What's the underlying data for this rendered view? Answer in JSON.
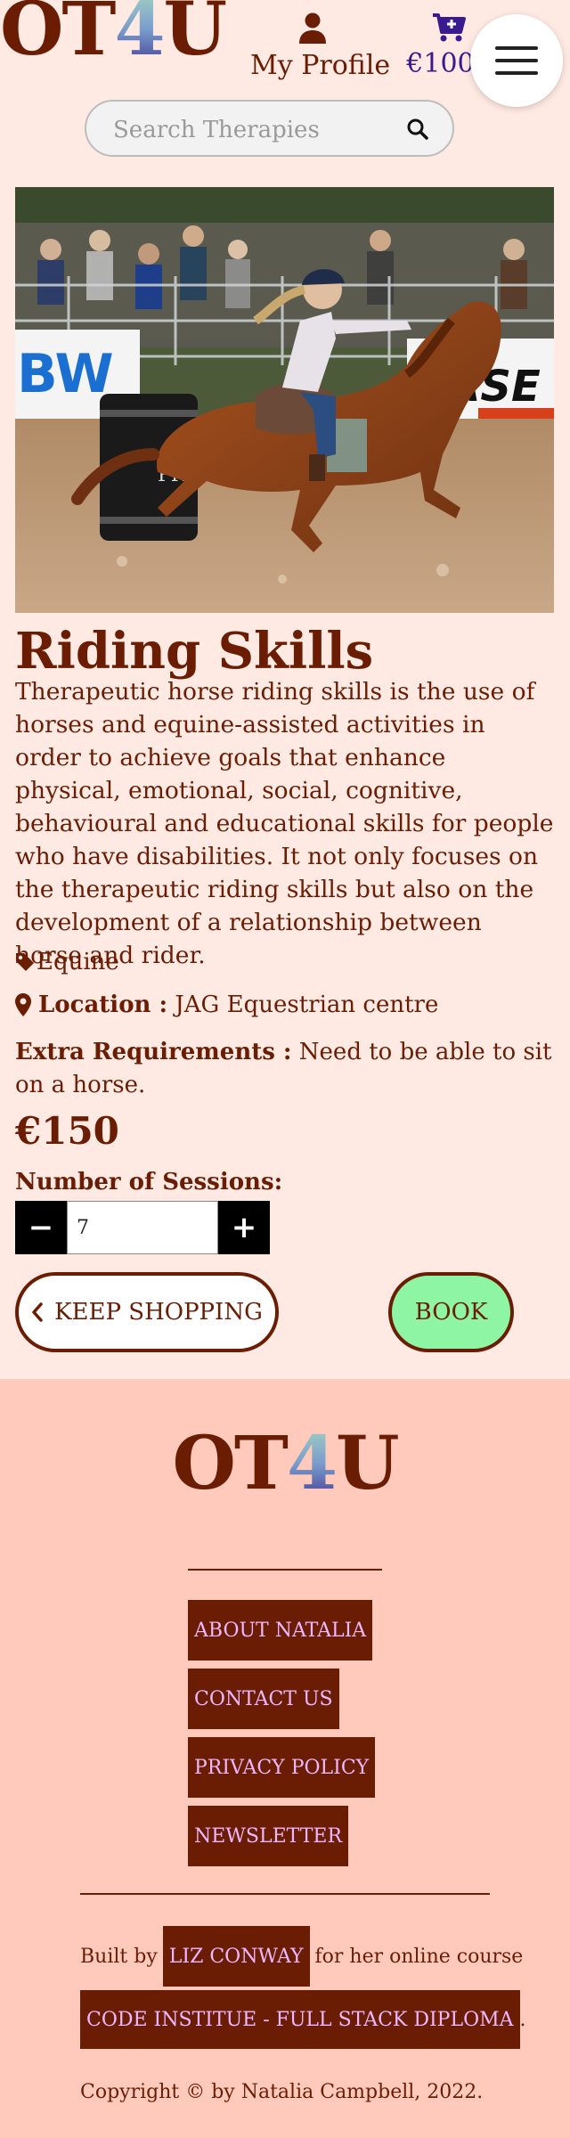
{
  "header": {
    "logo_left": "OT",
    "logo_four": "4",
    "logo_right": "U",
    "profile_label": "My Profile",
    "bag_amount": "€1000",
    "icons": {
      "profile": "user-icon",
      "bag": "cart-plus-icon",
      "menu": "hamburger-icon",
      "search": "search-icon"
    }
  },
  "search": {
    "placeholder": "Search Therapies",
    "value": ""
  },
  "product": {
    "image_alt": "Rider on a chestnut horse galloping around a barrel at a rodeo",
    "title": "Riding Skills",
    "description": "Therapeutic horse riding skills is the use of horses and equine-assisted activities in order to achieve goals that enhance physical, emotional, social, cognitive, behavioural and educational skills for people who have disabilities. It not only focuses on the therapeutic riding skills but also on the development of a relationship between horse and rider.",
    "category": "Equine",
    "location_label": "Location :",
    "location_value": "JAG Equestrian centre",
    "extra_label": "Extra Requirements :",
    "extra_value": "Need to be able to sit on a horse.",
    "price": "€150",
    "sessions_label": "Number of Sessions:",
    "sessions_value": "7",
    "minus": "−",
    "plus": "+",
    "keep_shopping": "KEEP SHOPPING",
    "book": "BOOK"
  },
  "footer": {
    "logo_left": "OT",
    "logo_four": "4",
    "logo_right": "U",
    "links": [
      "ABOUT NATALIA",
      "CONTACT US",
      "PRIVACY POLICY",
      "NEWSLETTER"
    ],
    "built_prefix": "Built by",
    "built_name": "LIZ CONWAY",
    "built_suffix": "for her online course",
    "course": "CODE INSTITUE - FULL STACK DIPLOMA",
    "course_suffix": ".",
    "copyright": "Copyright © by Natalia Campbell, 2022."
  },
  "colors": {
    "page_bg": "#ffe9e3",
    "footer_bg": "#ffcabb",
    "brand": "#6b1d04",
    "book_button": "#8ef5a5",
    "footer_link_text": "#f1b8ff",
    "bag_amount": "#3a1a8f"
  }
}
